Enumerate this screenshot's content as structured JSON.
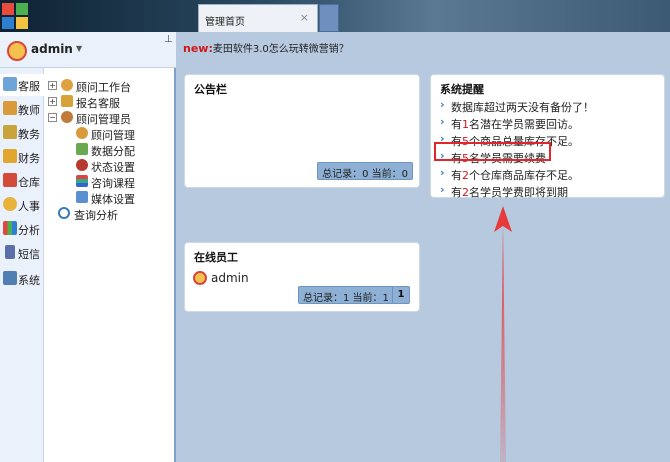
{
  "window": {
    "tab_label": "管理首页",
    "tab_close": "×"
  },
  "user": {
    "name": "admin",
    "caret": "▼",
    "pin": "⊥"
  },
  "modules": [
    {
      "label": "客服",
      "icon": "pen-icon",
      "color": "#6fa4d8"
    },
    {
      "label": "教师",
      "icon": "teacher-icon",
      "color": "#d89a3a"
    },
    {
      "label": "教务",
      "icon": "books-icon",
      "color": "#c9a43a"
    },
    {
      "label": "财务",
      "icon": "money-icon",
      "color": "#e0a62e"
    },
    {
      "label": "仓库",
      "icon": "warehouse-icon",
      "color": "#d44a3a"
    },
    {
      "label": "人事",
      "icon": "question-icon",
      "color": "#e8b33a"
    },
    {
      "label": "分析",
      "icon": "chart-icon",
      "color": "#5a9ad4"
    },
    {
      "label": "短信",
      "icon": "phone-icon",
      "color": "#5b6fa8"
    },
    {
      "label": "系统",
      "icon": "system-icon",
      "color": "#4f7fb3"
    }
  ],
  "tree": {
    "workbench": "顾问工作台",
    "signup": "报名客服",
    "admin": "顾问管理员",
    "admin_children": [
      "顾问管理",
      "数据分配",
      "状态设置",
      "咨询课程",
      "媒体设置"
    ],
    "analysis": "查询分析",
    "expand": "+",
    "collapse": "−"
  },
  "news": {
    "tag": "new:",
    "text": "麦田软件3.0怎么玩转微营销？"
  },
  "board": {
    "title": "公告栏",
    "pager": "总记录：0 当前：0"
  },
  "online": {
    "title": "在线员工",
    "user": "admin",
    "pager": "总记录：1 当前：1",
    "page_btn": "1"
  },
  "alerts": {
    "title": "系统提醒",
    "items": [
      {
        "pre": "数据库超过两天没有备份了！",
        "num": "",
        "post": ""
      },
      {
        "pre": "有",
        "num": "1",
        "post": "名潜在学员需要回访。"
      },
      {
        "pre": "有",
        "num": "5",
        "post": "个商品总量库存不足。"
      },
      {
        "pre": "有",
        "num": "5",
        "post": "名学员需要续费"
      },
      {
        "pre": "有",
        "num": "2",
        "post": "个仓库商品库存不足。"
      },
      {
        "pre": "有",
        "num": "2",
        "post": "名学员学费即将到期"
      }
    ]
  },
  "colors": {
    "accent": "#8db0d4",
    "alert": "#d0181b",
    "arrow": "#e8393b"
  }
}
